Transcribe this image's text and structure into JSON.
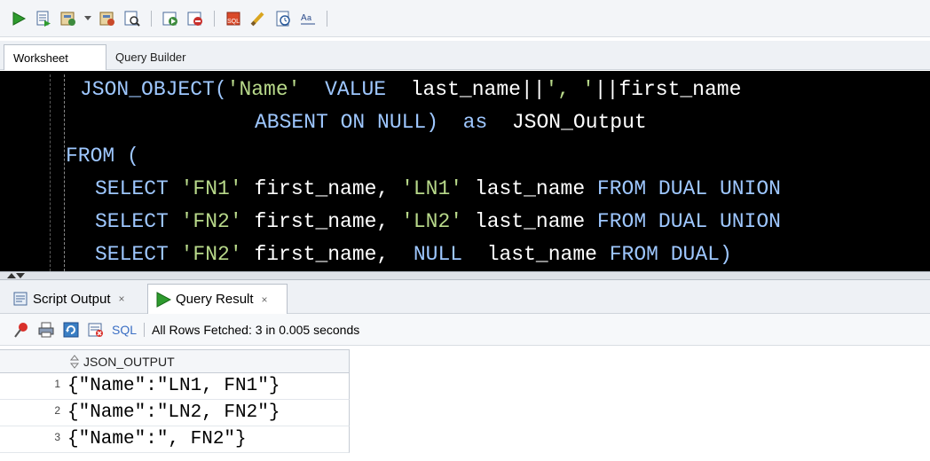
{
  "toolbar": {
    "icons": [
      "run-statement-icon",
      "run-script-icon",
      "commit-icon",
      "dropdown-arrow-icon",
      "rollback-icon",
      "explain-plan-icon",
      "autotrace-icon",
      "sql-tuning-icon",
      "unshared-sql-icon",
      "clear-icon",
      "history-icon",
      "format-case-icon"
    ]
  },
  "worksheet_tabs": {
    "worksheet": "Worksheet",
    "query_builder": "Query Builder"
  },
  "editor": {
    "lines": [
      [
        {
          "t": "JSON_OBJECT(",
          "c": "kw"
        },
        {
          "t": "'Name'",
          "c": "str"
        },
        {
          "t": "  VALUE  ",
          "c": "kw"
        },
        {
          "t": "last_name||",
          "c": "plain"
        },
        {
          "t": "', '",
          "c": "str"
        },
        {
          "t": "||first_name",
          "c": "plain"
        }
      ],
      [
        {
          "t": "ABSENT ON NULL)",
          "c": "kw"
        },
        {
          "t": "  as  ",
          "c": "kw"
        },
        {
          "t": "JSON_Output",
          "c": "plain"
        }
      ],
      [
        {
          "t": "FROM (",
          "c": "kw"
        }
      ],
      [
        {
          "t": "SELECT ",
          "c": "kw"
        },
        {
          "t": "'FN1'",
          "c": "str"
        },
        {
          "t": " first_name, ",
          "c": "plain"
        },
        {
          "t": "'LN1'",
          "c": "str"
        },
        {
          "t": " last_name ",
          "c": "plain"
        },
        {
          "t": "FROM DUAL UNION",
          "c": "kw"
        }
      ],
      [
        {
          "t": "SELECT ",
          "c": "kw"
        },
        {
          "t": "'FN2'",
          "c": "str"
        },
        {
          "t": " first_name, ",
          "c": "plain"
        },
        {
          "t": "'LN2'",
          "c": "str"
        },
        {
          "t": " last_name ",
          "c": "plain"
        },
        {
          "t": "FROM DUAL UNION",
          "c": "kw"
        }
      ],
      [
        {
          "t": "SELECT ",
          "c": "kw"
        },
        {
          "t": "'FN2'",
          "c": "str"
        },
        {
          "t": " first_name,  ",
          "c": "plain"
        },
        {
          "t": "NULL",
          "c": "kw"
        },
        {
          "t": "  last_name ",
          "c": "plain"
        },
        {
          "t": "FROM DUAL)",
          "c": "kw"
        }
      ]
    ]
  },
  "output_tabs": {
    "script_output": "Script Output",
    "query_result": "Query Result",
    "close": "×"
  },
  "result_toolbar": {
    "sql_label": "SQL",
    "status": "All Rows Fetched: 3 in 0.005 seconds"
  },
  "grid": {
    "column": "JSON_OUTPUT",
    "rows": [
      {
        "num": "1",
        "value": "{\"Name\":\"LN1, FN1\"}"
      },
      {
        "num": "2",
        "value": "{\"Name\":\"LN2, FN2\"}"
      },
      {
        "num": "3",
        "value": "{\"Name\":\", FN2\"}"
      }
    ]
  },
  "colors": {
    "editor_bg": "#000000",
    "keyword": "#9ec7ff",
    "string": "#b8d98a",
    "run_green": "#2e9b2e"
  }
}
